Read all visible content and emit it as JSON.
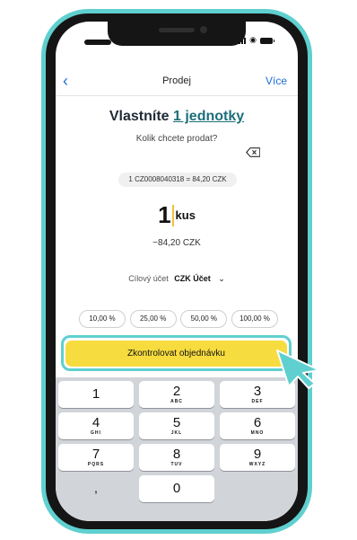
{
  "nav": {
    "back_icon": "chevron-left-icon",
    "title": "Prodej",
    "more": "Více"
  },
  "header": {
    "title_prefix": "Vlastníte ",
    "title_link": "1 jednotky",
    "subtitle": "Kolik chcete prodat?"
  },
  "instrument": {
    "price_info": "1 CZ0008040318 = 84,20 CZK"
  },
  "amount": {
    "quantity": "1",
    "unit": "kus",
    "approx_value": "~84,20 CZK"
  },
  "account": {
    "label": "Cílový účet",
    "value": "CZK Účet"
  },
  "percent_buttons": [
    "10,00 %",
    "25,00 %",
    "50,00 %",
    "100,00 %"
  ],
  "cta": {
    "label": "Zkontrolovat objednávku"
  },
  "keypad": {
    "keys": [
      {
        "digit": "1",
        "letters": ""
      },
      {
        "digit": "2",
        "letters": "ABC"
      },
      {
        "digit": "3",
        "letters": "DEF"
      },
      {
        "digit": "4",
        "letters": "GHI"
      },
      {
        "digit": "5",
        "letters": "JKL"
      },
      {
        "digit": "6",
        "letters": "MNO"
      },
      {
        "digit": "7",
        "letters": "PQRS"
      },
      {
        "digit": "8",
        "letters": "TUV"
      },
      {
        "digit": "9",
        "letters": "WXYZ"
      },
      {
        "digit": ",",
        "letters": ""
      },
      {
        "digit": "0",
        "letters": ""
      }
    ],
    "delete_icon": "backspace-icon"
  },
  "colors": {
    "accent_link": "#1c6f79",
    "ios_blue": "#1e6fd9",
    "cta_yellow": "#f7dc3f",
    "highlight_teal": "#5fd0cf",
    "phone_frame": "#151515"
  }
}
